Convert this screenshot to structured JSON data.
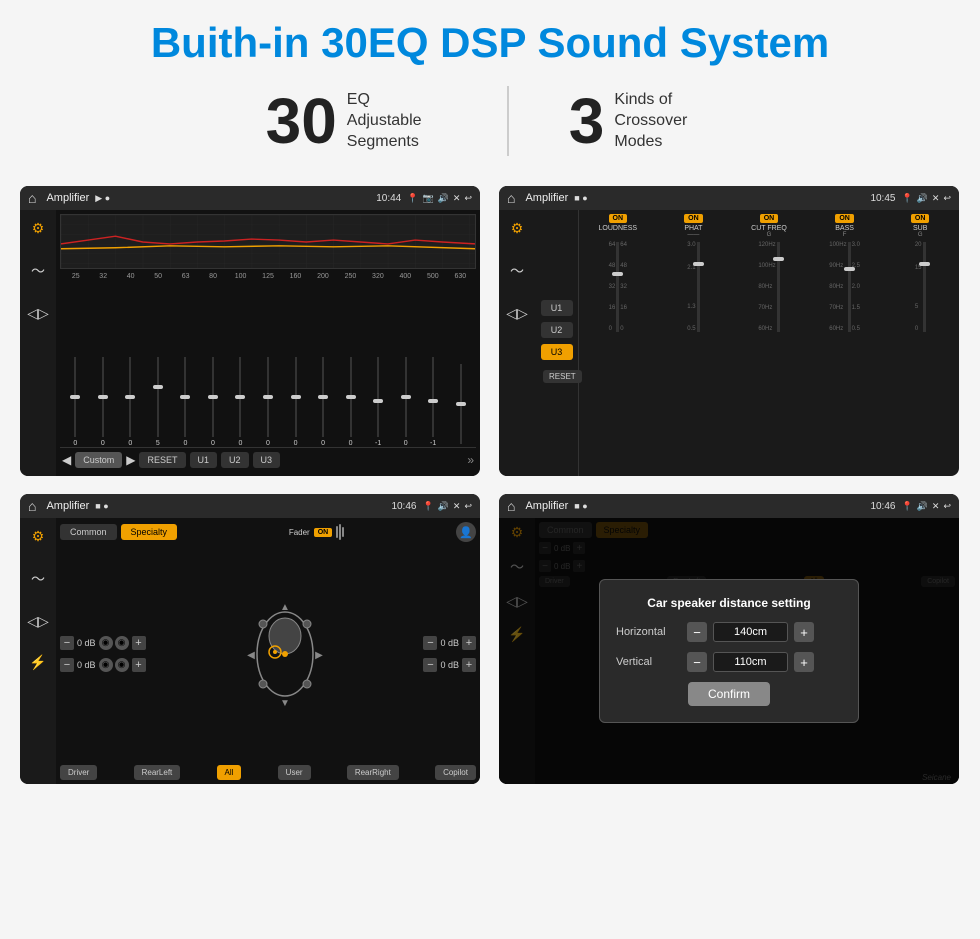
{
  "page": {
    "title": "Buith-in 30EQ DSP Sound System",
    "stat1_number": "30",
    "stat1_label": "EQ Adjustable\nSegments",
    "stat2_number": "3",
    "stat2_label": "Kinds of\nCrossover Modes"
  },
  "screen1": {
    "status": "Amplifier",
    "time": "10:44",
    "eq_freqs": [
      "25",
      "32",
      "40",
      "50",
      "63",
      "80",
      "100",
      "125",
      "160",
      "200",
      "250",
      "320",
      "400",
      "500",
      "630"
    ],
    "eq_vals": [
      "0",
      "0",
      "0",
      "5",
      "0",
      "0",
      "0",
      "0",
      "0",
      "0",
      "0",
      "-1",
      "0",
      "-1",
      ""
    ],
    "preset_label": "Custom",
    "buttons": [
      "RESET",
      "U1",
      "U2",
      "U3"
    ]
  },
  "screen2": {
    "status": "Amplifier",
    "time": "10:45",
    "selectors": [
      "U1",
      "U2",
      "U3"
    ],
    "active_selector": "U3",
    "channels": [
      {
        "name": "LOUDNESS",
        "on": true
      },
      {
        "name": "PHAT",
        "on": true
      },
      {
        "name": "CUT FREQ",
        "on": true
      },
      {
        "name": "BASS",
        "on": true
      },
      {
        "name": "SUB",
        "on": true
      }
    ],
    "reset_label": "RESET"
  },
  "screen3": {
    "status": "Amplifier",
    "time": "10:46",
    "tabs": [
      "Common",
      "Specialty"
    ],
    "active_tab": "Specialty",
    "fader_label": "Fader",
    "fader_on": true,
    "rows": [
      {
        "label": "",
        "value": "0 dB"
      },
      {
        "label": "",
        "value": "0 dB"
      },
      {
        "label": "",
        "value": "0 dB"
      },
      {
        "label": "",
        "value": "0 dB"
      }
    ],
    "positions": [
      "Driver",
      "RearLeft",
      "All",
      "User",
      "RearRight",
      "Copilot"
    ]
  },
  "screen4": {
    "status": "Amplifier",
    "time": "10:46",
    "tabs": [
      "Common",
      "Specialty"
    ],
    "active_tab": "Specialty",
    "dialog": {
      "title": "Car speaker distance setting",
      "horizontal_label": "Horizontal",
      "horizontal_value": "140cm",
      "vertical_label": "Vertical",
      "vertical_value": "110cm",
      "confirm_label": "Confirm"
    }
  },
  "watermark": "Seicane"
}
